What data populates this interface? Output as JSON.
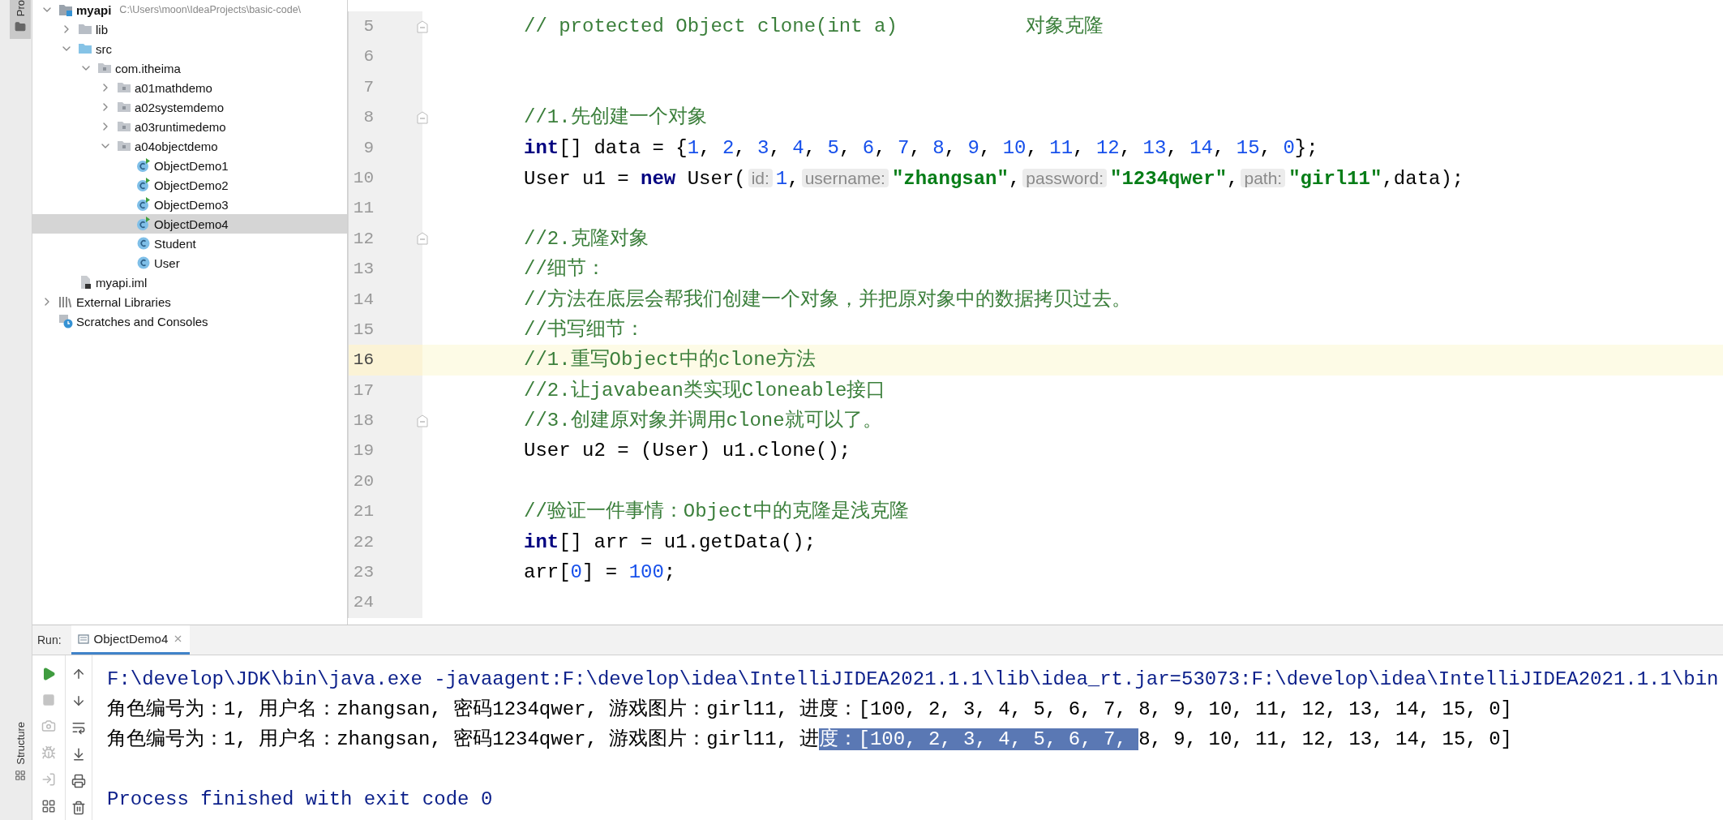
{
  "left_toolbar": [
    {
      "label": "Pro",
      "selected": true
    },
    {
      "label": "Structure",
      "selected": false
    }
  ],
  "project_tree": [
    {
      "label": "myapi",
      "path": "C:\\Users\\moon\\IdeaProjects\\basic-code\\",
      "kind": "module",
      "expanded": true,
      "selected": false,
      "children": [
        {
          "label": "lib",
          "kind": "folder",
          "expanded": false,
          "selected": false
        },
        {
          "label": "src",
          "kind": "source-folder",
          "expanded": true,
          "selected": false,
          "children": [
            {
              "label": "com.itheima",
              "kind": "package",
              "expanded": true,
              "selected": false,
              "children": [
                {
                  "label": "a01mathdemo",
                  "kind": "package",
                  "expanded": false,
                  "selected": false
                },
                {
                  "label": "a02systemdemo",
                  "kind": "package",
                  "expanded": false,
                  "selected": false
                },
                {
                  "label": "a03runtimedemo",
                  "kind": "package",
                  "expanded": false,
                  "selected": false
                },
                {
                  "label": "a04objectdemo",
                  "kind": "package",
                  "expanded": true,
                  "selected": false,
                  "children": [
                    {
                      "label": "ObjectDemo1",
                      "kind": "class-main",
                      "selected": false
                    },
                    {
                      "label": "ObjectDemo2",
                      "kind": "class-main",
                      "selected": false
                    },
                    {
                      "label": "ObjectDemo3",
                      "kind": "class-main",
                      "selected": false
                    },
                    {
                      "label": "ObjectDemo4",
                      "kind": "class-main",
                      "selected": true
                    },
                    {
                      "label": "Student",
                      "kind": "class",
                      "selected": false
                    },
                    {
                      "label": "User",
                      "kind": "class",
                      "selected": false
                    }
                  ]
                }
              ]
            }
          ]
        },
        {
          "label": "myapi.iml",
          "kind": "file",
          "selected": false
        }
      ]
    },
    {
      "label": "External Libraries",
      "kind": "libraries",
      "expanded": false,
      "selected": false
    },
    {
      "label": "Scratches and Consoles",
      "kind": "scratches",
      "selected": false
    }
  ],
  "editor": {
    "body_lines": [
      {
        "number": "5",
        "fold": true,
        "highlighted": false,
        "tokens": [
          {
            "kind": "comment",
            "text": "// protected Object clone(int a)           对象克隆"
          }
        ]
      },
      {
        "number": "6",
        "fold": false,
        "highlighted": false
      },
      {
        "number": "7",
        "fold": false,
        "highlighted": false
      },
      {
        "number": "8",
        "fold": true,
        "highlighted": false,
        "tokens": [
          {
            "kind": "comment",
            "text": "//1.先创建一个对象"
          }
        ]
      },
      {
        "number": "9",
        "fold": false,
        "highlighted": false,
        "tokens": [
          {
            "kind": "keyword",
            "text": "int"
          },
          {
            "kind": "plain",
            "text": "[] data = {"
          },
          {
            "kind": "number",
            "text": "1"
          },
          {
            "kind": "plain",
            "text": ", "
          },
          {
            "kind": "number",
            "text": "2"
          },
          {
            "kind": "plain",
            "text": ", "
          },
          {
            "kind": "number",
            "text": "3"
          },
          {
            "kind": "plain",
            "text": ", "
          },
          {
            "kind": "number",
            "text": "4"
          },
          {
            "kind": "plain",
            "text": ", "
          },
          {
            "kind": "number",
            "text": "5"
          },
          {
            "kind": "plain",
            "text": ", "
          },
          {
            "kind": "number",
            "text": "6"
          },
          {
            "kind": "plain",
            "text": ", "
          },
          {
            "kind": "number",
            "text": "7"
          },
          {
            "kind": "plain",
            "text": ", "
          },
          {
            "kind": "number",
            "text": "8"
          },
          {
            "kind": "plain",
            "text": ", "
          },
          {
            "kind": "number",
            "text": "9"
          },
          {
            "kind": "plain",
            "text": ", "
          },
          {
            "kind": "number",
            "text": "10"
          },
          {
            "kind": "plain",
            "text": ", "
          },
          {
            "kind": "number",
            "text": "11"
          },
          {
            "kind": "plain",
            "text": ", "
          },
          {
            "kind": "number",
            "text": "12"
          },
          {
            "kind": "plain",
            "text": ", "
          },
          {
            "kind": "number",
            "text": "13"
          },
          {
            "kind": "plain",
            "text": ", "
          },
          {
            "kind": "number",
            "text": "14"
          },
          {
            "kind": "plain",
            "text": ", "
          },
          {
            "kind": "number",
            "text": "15"
          },
          {
            "kind": "plain",
            "text": ", "
          },
          {
            "kind": "number",
            "text": "0"
          },
          {
            "kind": "plain",
            "text": "};"
          }
        ]
      },
      {
        "number": "10",
        "fold": false,
        "highlighted": false,
        "tokens": [
          {
            "kind": "plain",
            "text": "User u1 = "
          },
          {
            "kind": "keyword",
            "text": "new"
          },
          {
            "kind": "plain",
            "text": " User("
          },
          {
            "kind": "hint",
            "text": "id:"
          },
          {
            "kind": "number",
            "text": "1"
          },
          {
            "kind": "plain",
            "text": ","
          },
          {
            "kind": "hint",
            "text": "username:"
          },
          {
            "kind": "string",
            "text": "\"zhangsan\""
          },
          {
            "kind": "plain",
            "text": ","
          },
          {
            "kind": "hint",
            "text": "password:"
          },
          {
            "kind": "string",
            "text": "\"1234qwer\""
          },
          {
            "kind": "plain",
            "text": ","
          },
          {
            "kind": "hint",
            "text": "path:"
          },
          {
            "kind": "string",
            "text": "\"girl11\""
          },
          {
            "kind": "plain",
            "text": ",data);"
          }
        ]
      },
      {
        "number": "11",
        "fold": false,
        "highlighted": false
      },
      {
        "number": "12",
        "fold": true,
        "highlighted": false,
        "tokens": [
          {
            "kind": "comment",
            "text": "//2.克隆对象"
          }
        ]
      },
      {
        "number": "13",
        "fold": false,
        "highlighted": false,
        "tokens": [
          {
            "kind": "comment",
            "text": "//细节："
          }
        ]
      },
      {
        "number": "14",
        "fold": false,
        "highlighted": false,
        "tokens": [
          {
            "kind": "comment",
            "text": "//方法在底层会帮我们创建一个对象，并把原对象中的数据拷贝过去。"
          }
        ]
      },
      {
        "number": "15",
        "fold": false,
        "highlighted": false,
        "tokens": [
          {
            "kind": "comment",
            "text": "//书写细节："
          }
        ]
      },
      {
        "number": "16",
        "fold": false,
        "highlighted": true,
        "tokens": [
          {
            "kind": "comment",
            "text": "//1.重写Object中的clone方法"
          }
        ]
      },
      {
        "number": "17",
        "fold": false,
        "highlighted": false,
        "tokens": [
          {
            "kind": "comment",
            "text": "//2.让javabean类实现Cloneable接口"
          }
        ]
      },
      {
        "number": "18",
        "fold": true,
        "highlighted": false,
        "tokens": [
          {
            "kind": "comment",
            "text": "//3.创建原对象并调用clone就可以了。"
          }
        ]
      },
      {
        "number": "19",
        "fold": false,
        "highlighted": false,
        "tokens": [
          {
            "kind": "plain",
            "text": "User u2 = (User) u1.clone();"
          }
        ]
      },
      {
        "number": "20",
        "fold": false,
        "highlighted": false
      },
      {
        "number": "21",
        "fold": false,
        "highlighted": false,
        "tokens": [
          {
            "kind": "comment",
            "text": "//验证一件事情：Object中的克隆是浅克隆"
          }
        ]
      },
      {
        "number": "22",
        "fold": false,
        "highlighted": false,
        "tokens": [
          {
            "kind": "keyword",
            "text": "int"
          },
          {
            "kind": "plain",
            "text": "[] arr = u1.getData();"
          }
        ]
      },
      {
        "number": "23",
        "fold": false,
        "highlighted": false,
        "tokens": [
          {
            "kind": "plain",
            "text": "arr["
          },
          {
            "kind": "number",
            "text": "0"
          },
          {
            "kind": "plain",
            "text": "] = "
          },
          {
            "kind": "number",
            "text": "100"
          },
          {
            "kind": "plain",
            "text": ";"
          }
        ]
      },
      {
        "number": "24",
        "fold": false,
        "highlighted": false
      }
    ]
  },
  "run_panel": {
    "label": "Run:",
    "tabs": [
      {
        "label": "ObjectDemo4",
        "selected": true
      }
    ],
    "console": [
      {
        "kind": "command",
        "segments": [
          {
            "text": "F:\\develop\\JDK\\bin\\java.exe -javaagent:F:\\develop\\idea\\IntelliJIDEA2021.1.1\\lib\\idea_rt.jar=53073:F:\\develop\\idea\\IntelliJIDEA2021.1.1\\bin",
            "selected": false
          }
        ]
      },
      {
        "kind": "output",
        "segments": [
          {
            "text": "角色编号为：1, 用户名：zhangsan, 密码1234qwer, 游戏图片：girl11, 进度：[100, 2, 3, 4, 5, 6, 7, 8, 9, 10, 11, 12, 13, 14, 15, 0]",
            "selected": false
          }
        ]
      },
      {
        "kind": "output",
        "segments": [
          {
            "text": "角色编号为：1, 用户名：zhangsan, 密码1234qwer, 游戏图片：girl11, 进",
            "selected": false
          },
          {
            "text": "度：[100, 2, 3, 4, 5, 6, 7, ",
            "selected": true
          },
          {
            "text": "8, 9, 10, 11, 12, 13, 14, 15, 0]",
            "selected": false
          }
        ]
      },
      {
        "kind": "exit",
        "segments": [
          {
            "text": "Process finished with exit code 0",
            "selected": false
          }
        ]
      }
    ]
  }
}
